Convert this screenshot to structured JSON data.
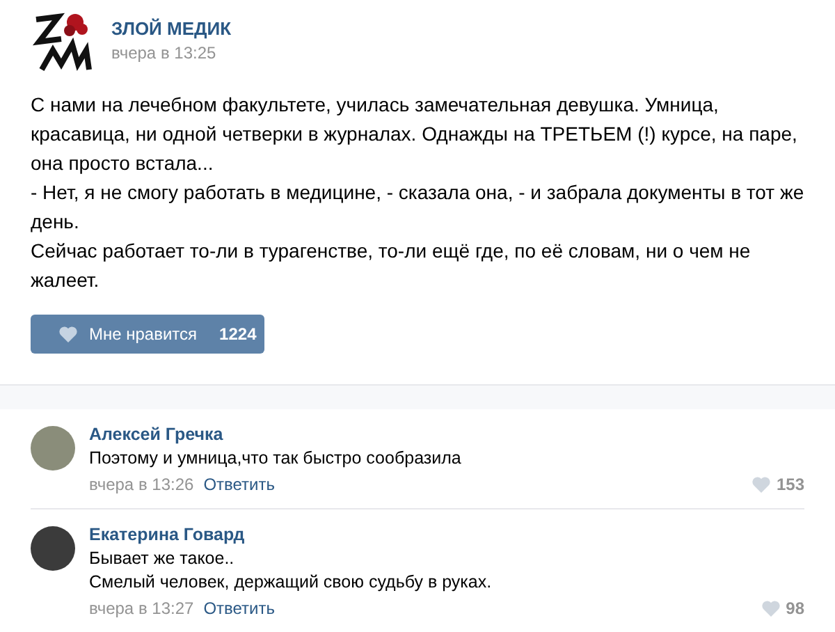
{
  "post": {
    "author": "ЗЛОЙ МЕДИК",
    "time": "вчера в 13:25",
    "paragraphs": [
      "С нами на лечебном факультете, училась замечательная девушка. Умница, красавица, ни одной четверки в журналах. Однажды на ТРЕТЬЕМ (!) курсе, на паре, она просто встала...",
      "- Нет, я не смогу работать в медицине, - сказала она, - и забрала документы в тот же день.",
      "Сейчас работает то-ли в турагенстве, то-ли ещё где, по её словам, ни о чем не жалеет."
    ],
    "like_button": {
      "label": "Мне нравится",
      "count": "1224"
    }
  },
  "comments": [
    {
      "author": "Алексей Гречка",
      "lines": [
        "Поэтому и умница,что так быстро сообразила"
      ],
      "time": "вчера в 13:26",
      "reply": "Ответить",
      "likes": "153"
    },
    {
      "author": "Екатерина Говард",
      "lines": [
        "Бывает же такое..",
        "Смелый человек, держащий свою судьбу в руках."
      ],
      "time": "вчера в 13:27",
      "reply": "Ответить",
      "likes": "98"
    }
  ]
}
